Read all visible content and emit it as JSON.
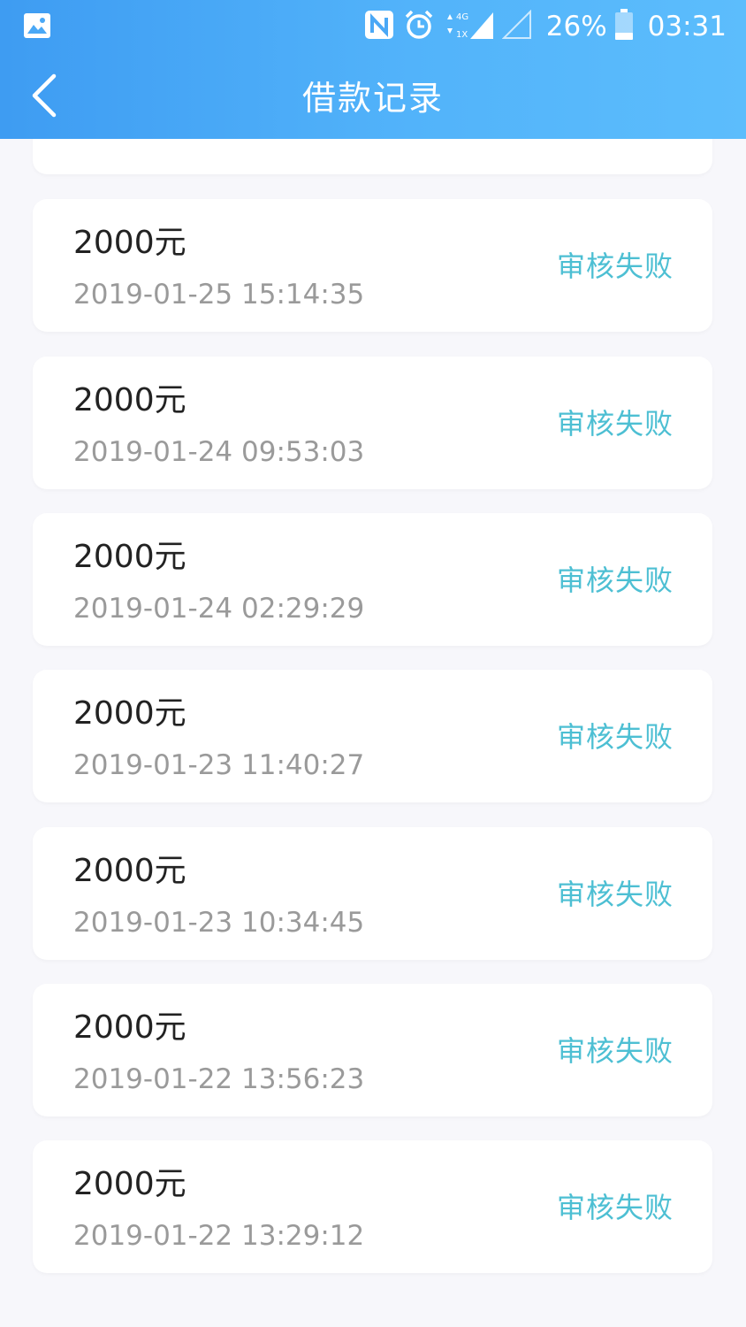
{
  "status_bar": {
    "battery": "26%",
    "time": "03:31",
    "network": "4G",
    "network_sub": "1X",
    "icons": [
      "image-icon",
      "nfc-icon",
      "alarm-icon",
      "signal-icon",
      "signal-empty-icon",
      "battery-icon"
    ]
  },
  "header": {
    "title": "借款记录",
    "back_icon": "chevron-left-icon"
  },
  "colors": {
    "header_start": "#3e9cf2",
    "header_end": "#5cbdfc",
    "status_text": "#4dbfd3",
    "background": "#f7f7fb"
  },
  "records": [
    {
      "amount": "2000元",
      "datetime": "2019-01-25 15:14:35",
      "status": "审核失败"
    },
    {
      "amount": "2000元",
      "datetime": "2019-01-24 09:53:03",
      "status": "审核失败"
    },
    {
      "amount": "2000元",
      "datetime": "2019-01-24 02:29:29",
      "status": "审核失败"
    },
    {
      "amount": "2000元",
      "datetime": "2019-01-23 11:40:27",
      "status": "审核失败"
    },
    {
      "amount": "2000元",
      "datetime": "2019-01-23 10:34:45",
      "status": "审核失败"
    },
    {
      "amount": "2000元",
      "datetime": "2019-01-22 13:56:23",
      "status": "审核失败"
    },
    {
      "amount": "2000元",
      "datetime": "2019-01-22 13:29:12",
      "status": "审核失败"
    }
  ]
}
